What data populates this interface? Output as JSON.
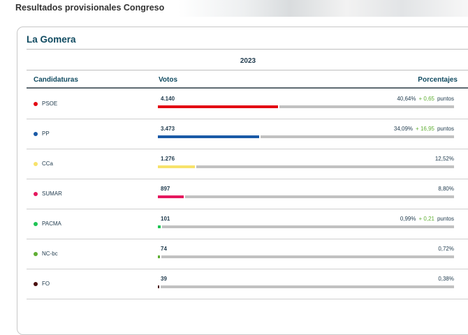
{
  "page": {
    "title": "Resultados provisionales Congreso"
  },
  "card": {
    "region": "La Gomera",
    "year": "2023",
    "headers": {
      "candidaturas": "Candidaturas",
      "votos": "Votos",
      "porcentajes": "Porcentajes"
    }
  },
  "rows": [
    {
      "name": "PSOE",
      "votes": "4.140",
      "pct": "40,64%",
      "pct_value": 40.64,
      "delta": "+ 0,65",
      "delta_unit": "puntos",
      "color": "#e30613"
    },
    {
      "name": "PP",
      "votes": "3.473",
      "pct": "34,09%",
      "pct_value": 34.09,
      "delta": "+ 16,95",
      "delta_unit": "puntos",
      "color": "#1a5aa6"
    },
    {
      "name": "CCa",
      "votes": "1.276",
      "pct": "12,52%",
      "pct_value": 12.52,
      "delta": "",
      "delta_unit": "",
      "color": "#f7e26b"
    },
    {
      "name": "SUMAR",
      "votes": "897",
      "pct": "8,80%",
      "pct_value": 8.8,
      "delta": "",
      "delta_unit": "",
      "color": "#e5185e"
    },
    {
      "name": "PACMA",
      "votes": "101",
      "pct": "0,99%",
      "pct_value": 0.99,
      "delta": "+ 0,21",
      "delta_unit": "puntos",
      "color": "#1fc454"
    },
    {
      "name": "NC-bc",
      "votes": "74",
      "pct": "0,72%",
      "pct_value": 0.72,
      "delta": "",
      "delta_unit": "",
      "color": "#5fae33"
    },
    {
      "name": "FO",
      "votes": "39",
      "pct": "0,38%",
      "pct_value": 0.38,
      "delta": "",
      "delta_unit": "",
      "color": "#4a0f0f"
    }
  ]
}
